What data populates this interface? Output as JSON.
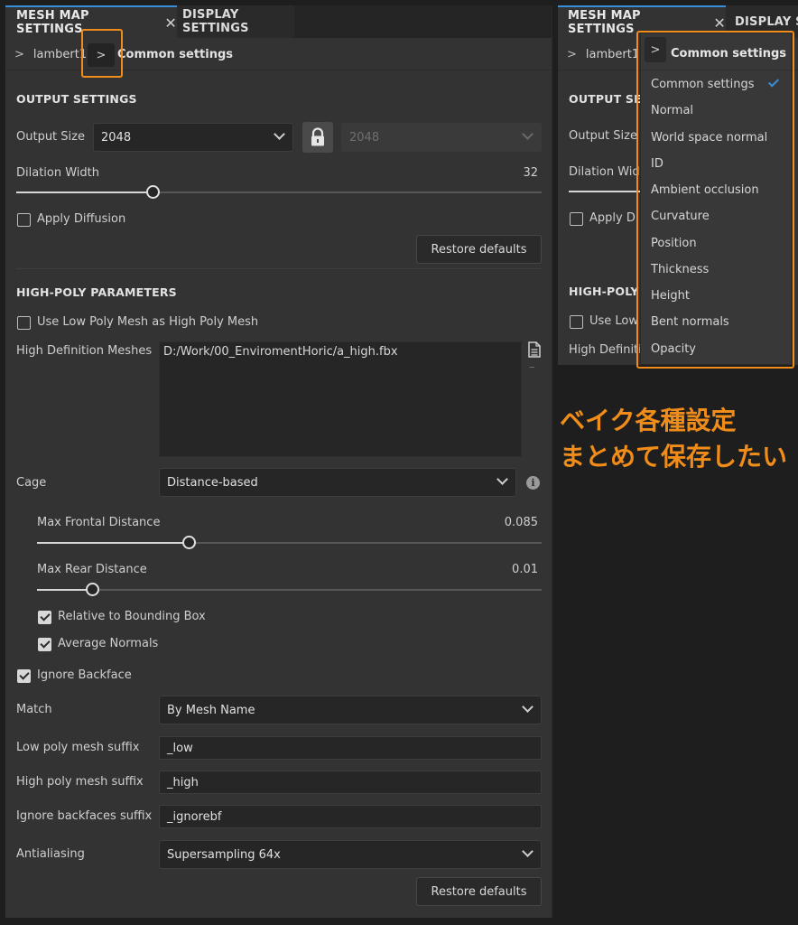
{
  "left_panel": {
    "tabs": [
      {
        "label": "MESH MAP SETTINGS",
        "close": "✕"
      },
      {
        "label": "DISPLAY SETTINGS"
      }
    ],
    "breadcrumb": {
      "root": "lambert1",
      "current": "Common settings",
      "sep": ">"
    },
    "output_settings": {
      "title": "OUTPUT SETTINGS",
      "output_size_label": "Output Size",
      "output_size_value": "2048",
      "output_size_locked_value": "2048",
      "dilation_width_label": "Dilation Width",
      "dilation_width_value": "32",
      "dilation_width_fraction": 0.26,
      "apply_diffusion_label": "Apply Diffusion",
      "apply_diffusion_checked": false,
      "restore_defaults_label": "Restore defaults"
    },
    "high_poly": {
      "title": "HIGH-POLY PARAMETERS",
      "use_low_poly_label": "Use Low Poly Mesh as High Poly Mesh",
      "use_low_poly_checked": false,
      "hd_meshes_label": "High Definition Meshes",
      "hd_meshes_value": "D:/Work/00_EnviromentHoric/a_high.fbx",
      "minus": "–"
    },
    "cage": {
      "label": "Cage",
      "value": "Distance-based",
      "max_frontal_label": "Max Frontal Distance",
      "max_frontal_value": "0.085",
      "max_frontal_fraction": 0.3,
      "max_rear_label": "Max Rear Distance",
      "max_rear_value": "0.01",
      "max_rear_fraction": 0.11,
      "relative_bbox_label": "Relative to Bounding Box",
      "relative_bbox_checked": true,
      "average_normals_label": "Average Normals",
      "average_normals_checked": true
    },
    "ignore_backface_label": "Ignore Backface",
    "ignore_backface_checked": true,
    "match_label": "Match",
    "match_value": "By Mesh Name",
    "low_suffix_label": "Low poly mesh suffix",
    "low_suffix_value": "_low",
    "high_suffix_label": "High poly mesh suffix",
    "high_suffix_value": "_high",
    "ignore_suffix_label": "Ignore backfaces suffix",
    "ignore_suffix_value": "_ignorebf",
    "antialiasing_label": "Antialiasing",
    "antialiasing_value": "Supersampling 64x",
    "restore_defaults_label": "Restore defaults"
  },
  "right_panel": {
    "tabs": [
      {
        "label": "MESH MAP SETTINGS",
        "close": "✕"
      },
      {
        "label": "DISPLAY S"
      }
    ],
    "breadcrumb_root": "lambert1",
    "breadcrumb_current": "Common settings",
    "partial_labels": {
      "output": "OUTPUT SET",
      "output_size": "Output Size",
      "dilation": "Dilation Widt",
      "apply": "Apply Di",
      "high_poly": "HIGH-POLY P",
      "use_low": "Use Low I",
      "hd": "High Definiti"
    },
    "dropdown_items": [
      "Common settings",
      "Normal",
      "World space normal",
      "ID",
      "Ambient occlusion",
      "Curvature",
      "Position",
      "Thickness",
      "Height",
      "Bent normals",
      "Opacity"
    ],
    "selected_item": "Common settings"
  },
  "annotation": {
    "line1": "ベイク各種設定",
    "line2": "まとめて保存したい",
    "color": "#f08c1a"
  },
  "colors": {
    "accent_blue": "#3b8fd9",
    "highlight_orange": "#f08c1a",
    "panel_bg": "#333333",
    "page_bg": "#1e1e1e"
  }
}
